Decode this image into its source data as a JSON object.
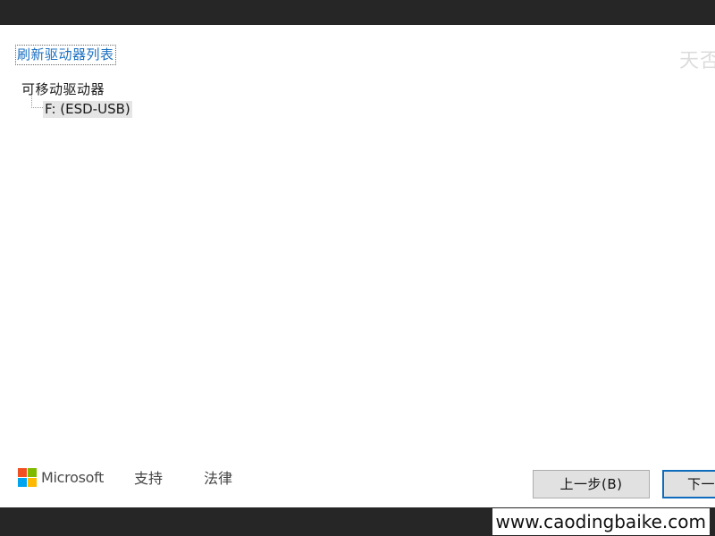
{
  "drive_list": {
    "refresh_link": "刷新驱动器列表",
    "group_label": "可移动驱动器",
    "items": [
      {
        "label": "F: (ESD-USB)",
        "selected": true
      }
    ]
  },
  "overlay": {
    "top_right_watermark": "天否",
    "site_watermark": "www.caodingbaike.com"
  },
  "footer": {
    "brand": "Microsoft",
    "brand_colors": [
      "#f25022",
      "#7fba00",
      "#00a4ef",
      "#ffb900"
    ],
    "support_label": "支持",
    "legal_label": "法律",
    "back_button": "上一步(B)",
    "next_button": "下一"
  },
  "colors": {
    "accent": "#0f6cbd",
    "link": "#1a6fc1"
  }
}
